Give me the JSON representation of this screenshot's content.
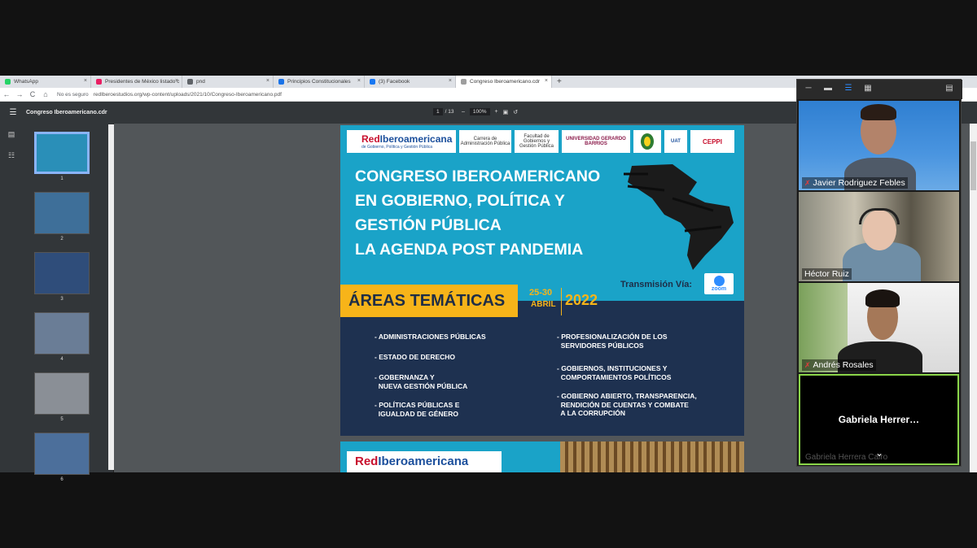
{
  "browser": {
    "tabs": [
      {
        "label": "WhatsApp",
        "color": "#25d366"
      },
      {
        "label": "Presidentes de México listado c",
        "color": "#e91e63"
      },
      {
        "label": "pnd",
        "color": "#5f6368"
      },
      {
        "label": "Principios Constitucionales",
        "color": "#1a73e8"
      },
      {
        "label": "(3) Facebook",
        "color": "#1877f2"
      },
      {
        "label": "Congreso Iberoamericano.cdr",
        "color": "#9e9e9e"
      }
    ],
    "new_tab": "+",
    "nav": {
      "back": "←",
      "forward": "→",
      "reload": "C",
      "home": "⌂"
    },
    "security_label": "No es seguro",
    "url": "redIberoestudios.org/wp-content/uploads/2021/10/Congreso-Iberoamericano.pdf"
  },
  "pdf_toolbar": {
    "title": "Congreso Iberoamericano.cdr",
    "page_current": "1",
    "page_total": "/ 13",
    "zoom_minus": "–",
    "zoom_value": "100%",
    "zoom_plus": "+"
  },
  "thumbnails": {
    "pages": [
      "1",
      "2",
      "3",
      "4",
      "5",
      "6"
    ],
    "selected": 1
  },
  "pdf_page": {
    "logos": {
      "red": "Red",
      "ibero": "Iberoamericana",
      "ibero_sub": "de Gobierno, Política y Gestión Pública",
      "unl": "Carrera de Administración Pública",
      "fac": "Facultad de Gobiernos y Gestión Pública",
      "ugb": "UNIVERSIDAD GERARDO BARRIOS",
      "uat": "UAT",
      "ceppi": "CEPPI"
    },
    "title_lines": [
      "CONGRESO IBEROAMERICANO",
      "EN GOBIERNO, POLÍTICA Y",
      "GESTIÓN PÚBLICA",
      "LA AGENDA POST PANDEMIA"
    ],
    "transmission": "Transmisión Vía:",
    "zoom_logo_text": "zoom",
    "areas_title": "ÁREAS TEMÁTICAS",
    "dates": {
      "days": "25-30",
      "month": "ABRIL",
      "year": "2022"
    },
    "topics_left": [
      [
        "- ADMINISTRACIONES PÚBLICAS"
      ],
      [
        "- ESTADO DE DERECHO"
      ],
      [
        "- GOBERNANZA Y",
        "  NUEVA GESTIÓN PÚBLICA"
      ],
      [
        "- POLÍTICAS PÚBLICAS E",
        "  IGUALDAD DE GÉNERO"
      ]
    ],
    "topics_right": [
      [
        "- PROFESIONALIZACIÓN DE LOS",
        "  SERVIDORES PÚBLICOS"
      ],
      [
        "- GOBIERNOS, INSTITUCIONES Y",
        "  COMPORTAMIENTOS POLÍTICOS"
      ],
      [
        "- GOBIERNO ABIERTO, TRANSPARENCIA,",
        "  RENDICIÓN DE CUENTAS Y COMBATE",
        "  A LA CORRUPCIÓN"
      ]
    ]
  },
  "pdf_page2": {
    "red": "Red",
    "ibero": "Iberoamericana"
  },
  "zoom_meeting": {
    "participants": [
      {
        "name": "Javier Rodriguez Febles",
        "muted": true
      },
      {
        "name": "Héctor Ruiz",
        "muted": false
      },
      {
        "name": "Andrés Rosales",
        "muted": true
      }
    ],
    "active_speaker_card": {
      "display_name": "Gabriela  Herrer…",
      "full_name": "Gabriela Herrera Cairo"
    }
  }
}
